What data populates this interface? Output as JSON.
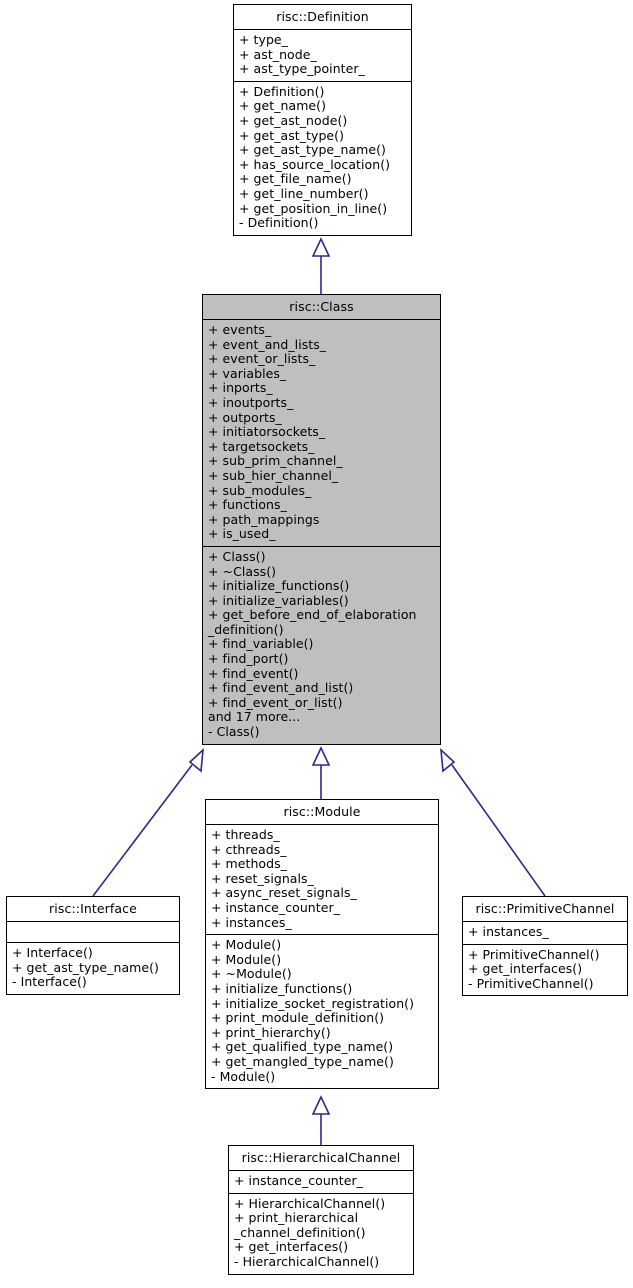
{
  "diagram": {
    "kind": "uml-inheritance-diagram",
    "highlight_color": "#bfbfbf",
    "edge_color": "#2a2a8c",
    "box_border_color": "#000000",
    "background_color": "#ffffff",
    "classes": [
      {
        "id": "definition",
        "name": "risc::Definition",
        "highlighted": false,
        "attributes": [
          "+ type_",
          "+ ast_node_",
          "+ ast_type_pointer_"
        ],
        "methods": [
          "+ Definition()",
          "+ get_name()",
          "+ get_ast_node()",
          "+ get_ast_type()",
          "+ get_ast_type_name()",
          "+ has_source_location()",
          "+ get_file_name()",
          "+ get_line_number()",
          "+ get_position_in_line()",
          "- Definition()"
        ]
      },
      {
        "id": "class",
        "name": "risc::Class",
        "highlighted": true,
        "attributes": [
          "+ events_",
          "+ event_and_lists_",
          "+ event_or_lists_",
          "+ variables_",
          "+ inports_",
          "+ inoutports_",
          "+ outports_",
          "+ initiatorsockets_",
          "+ targetsockets_",
          "+ sub_prim_channel_",
          "+ sub_hier_channel_",
          "+ sub_modules_",
          "+ functions_",
          "+ path_mappings",
          "+ is_used_"
        ],
        "methods": [
          "+ Class()",
          "+ ~Class()",
          "+ initialize_functions()",
          "+ initialize_variables()",
          "+ get_before_end_of_elaboration",
          "_definition()",
          "+ find_variable()",
          "+ find_port()",
          "+ find_event()",
          "+ find_event_and_list()",
          "+ find_event_or_list()",
          "and 17 more...",
          "- Class()"
        ]
      },
      {
        "id": "interface",
        "name": "risc::Interface",
        "highlighted": false,
        "attributes": [],
        "methods": [
          "+ Interface()",
          "+ get_ast_type_name()",
          "- Interface()"
        ]
      },
      {
        "id": "module",
        "name": "risc::Module",
        "highlighted": false,
        "attributes": [
          "+ threads_",
          "+ cthreads_",
          "+ methods_",
          "+ reset_signals_",
          "+ async_reset_signals_",
          "+ instance_counter_",
          "+ instances_"
        ],
        "methods": [
          "+ Module()",
          "+ Module()",
          "+ ~Module()",
          "+ initialize_functions()",
          "+ initialize_socket_registration()",
          "+ print_module_definition()",
          "+ print_hierarchy()",
          "+ get_qualified_type_name()",
          "+ get_mangled_type_name()",
          "- Module()"
        ]
      },
      {
        "id": "primitivechannel",
        "name": "risc::PrimitiveChannel",
        "highlighted": false,
        "attributes": [
          "+ instances_"
        ],
        "methods": [
          "+ PrimitiveChannel()",
          "+ get_interfaces()",
          "- PrimitiveChannel()"
        ]
      },
      {
        "id": "hierarchicalchannel",
        "name": "risc::HierarchicalChannel",
        "highlighted": false,
        "attributes": [
          "+ instance_counter_"
        ],
        "methods": [
          "+ HierarchicalChannel()",
          "+ print_hierarchical",
          "_channel_definition()",
          "+ get_interfaces()",
          "- HierarchicalChannel()"
        ]
      }
    ],
    "inheritance_edges": [
      {
        "from": "class",
        "to": "definition"
      },
      {
        "from": "interface",
        "to": "class"
      },
      {
        "from": "module",
        "to": "class"
      },
      {
        "from": "primitivechannel",
        "to": "class"
      },
      {
        "from": "hierarchicalchannel",
        "to": "module"
      }
    ]
  }
}
